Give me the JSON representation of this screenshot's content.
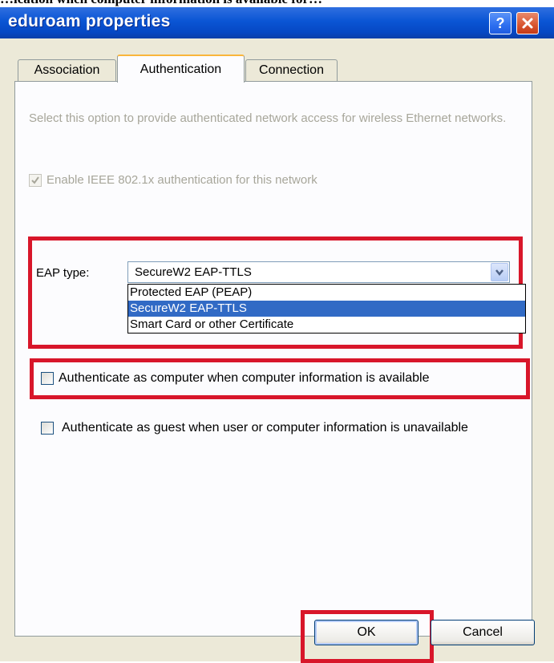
{
  "window": {
    "title": "eduroam properties",
    "top_text_fragment": "…ication when computer information is available for…"
  },
  "tabs": [
    {
      "label": "Association",
      "active": false
    },
    {
      "label": "Authentication",
      "active": true
    },
    {
      "label": "Connection",
      "active": false
    }
  ],
  "panel": {
    "description": "Select this option to provide authenticated network access for wireless Ethernet networks.",
    "enable_8021x": {
      "label": "Enable IEEE 802.1x authentication for this network",
      "checked": true,
      "disabled": true
    },
    "eap_type": {
      "label": "EAP type:",
      "selected": "SecureW2 EAP-TTLS",
      "options": [
        "Protected EAP (PEAP)",
        "SecureW2 EAP-TTLS",
        "Smart Card or other Certificate"
      ],
      "highlighted_index": 1
    },
    "auth_as_computer": {
      "label": "Authenticate as computer when computer information is available",
      "checked": false
    },
    "auth_as_guest": {
      "label": "Authenticate as guest when user or computer information is unavailable",
      "checked": false
    }
  },
  "buttons": {
    "ok": "OK",
    "cancel": "Cancel"
  },
  "colors": {
    "title_bar": "#0a55d4",
    "dialog_bg": "#ece9d8",
    "highlight": "#d8162a",
    "selection": "#316ac5",
    "disabled_text": "#a7a69a"
  },
  "icons": {
    "help": "help-icon",
    "close": "close-icon",
    "dropdown": "chevron-down-icon",
    "check": "check-icon"
  }
}
